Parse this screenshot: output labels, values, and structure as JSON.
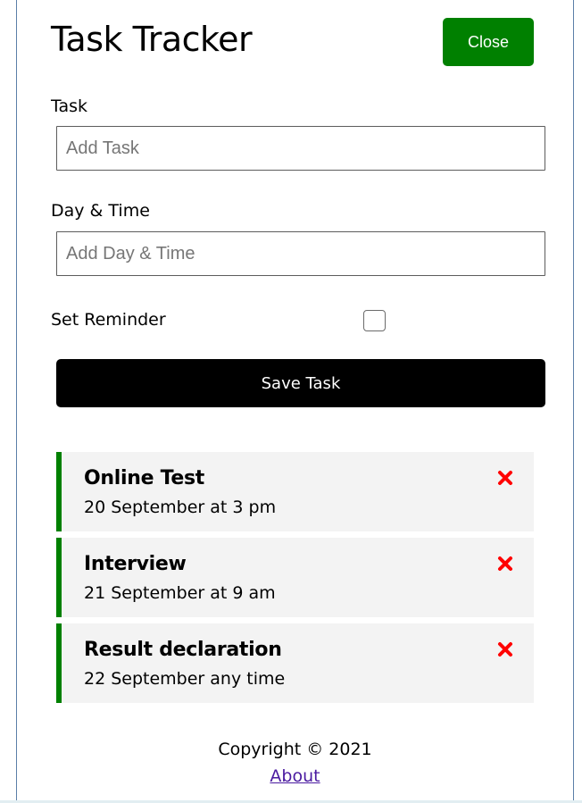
{
  "header": {
    "title": "Task Tracker",
    "close_label": "Close"
  },
  "form": {
    "task_label": "Task",
    "task_placeholder": "Add Task",
    "task_value": "",
    "day_label": "Day & Time",
    "day_placeholder": "Add Day & Time",
    "day_value": "",
    "reminder_label": "Set Reminder",
    "reminder_checked": false,
    "save_label": "Save Task"
  },
  "tasks": [
    {
      "title": "Online Test",
      "day": "20 September at 3 pm",
      "reminder": true
    },
    {
      "title": "Interview",
      "day": "21 September at 9 am",
      "reminder": true
    },
    {
      "title": "Result declaration",
      "day": "22 September any time",
      "reminder": true
    }
  ],
  "footer": {
    "copyright": "Copyright © 2021",
    "about_label": "About"
  },
  "icons": {
    "delete": "x-icon"
  },
  "colors": {
    "accent_green": "#008000",
    "delete_red": "#ff0000",
    "task_bg": "#f3f3f3",
    "save_bg": "#000000"
  }
}
